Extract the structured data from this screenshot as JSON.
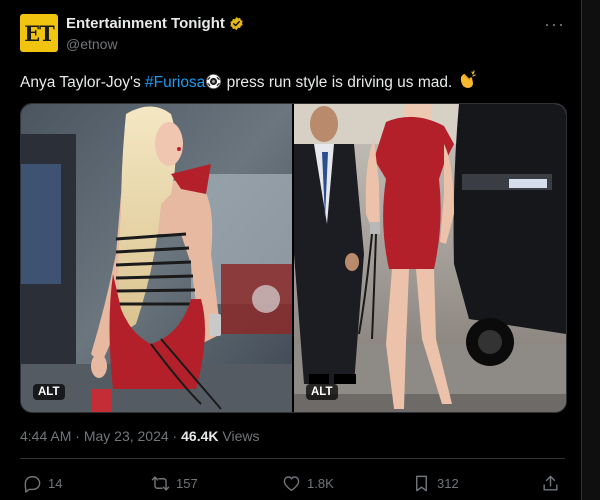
{
  "account": {
    "logo_text": "ET",
    "display_name": "Entertainment Tonight",
    "handle": "@etnow"
  },
  "post": {
    "text_before": "Anya Taylor-Joy's ",
    "hashtag": "#Furiosa",
    "text_after": " press run style is driving us mad. ",
    "media": [
      {
        "alt_label": "ALT"
      },
      {
        "alt_label": "ALT"
      }
    ],
    "time": "4:44 AM",
    "separator": " · ",
    "date": "May 23, 2024",
    "views_count": "46.4K",
    "views_label": " Views"
  },
  "actions": {
    "reply_count": "14",
    "repost_count": "157",
    "like_count": "1.8K",
    "bookmark_count": "312"
  },
  "colors": {
    "background": "#000000",
    "text": "#e7e9ea",
    "muted": "#71767b",
    "link": "#1d9bf0",
    "verified_gold": "#e2b719",
    "dress_red": "#b3202a"
  },
  "icons": [
    "verified-badge-icon",
    "more-options-icon",
    "reply-icon",
    "repost-icon",
    "like-icon",
    "bookmark-icon",
    "share-icon"
  ]
}
